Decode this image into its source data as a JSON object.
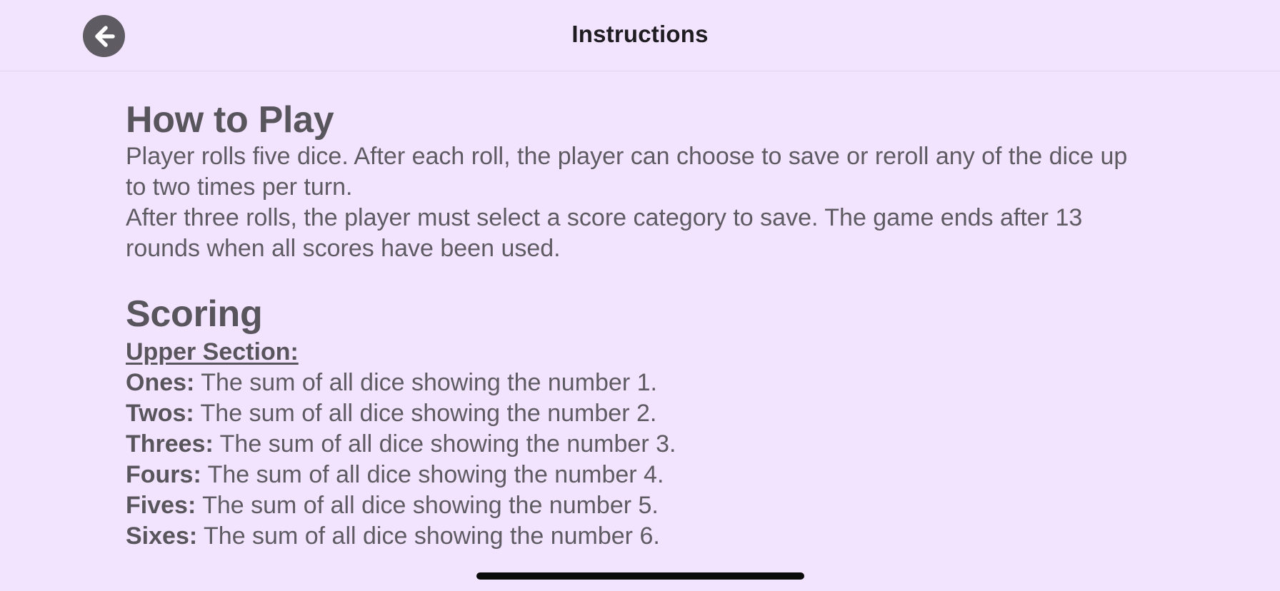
{
  "nav": {
    "title": "Instructions",
    "back_icon": "arrow-left-circle-icon"
  },
  "how_to_play": {
    "heading": "How to Play",
    "paragraphs": [
      "Player rolls five dice. After each roll, the player can choose to save or reroll any of the dice up to two times per turn.",
      "After three rolls, the player must select a score category to save. The game ends after 13 rounds when all scores have been used."
    ]
  },
  "scoring": {
    "heading": "Scoring",
    "upper_section_label": "Upper Section:",
    "items": [
      {
        "name": "Ones:",
        "desc": " The sum of all dice showing the number 1."
      },
      {
        "name": "Twos:",
        "desc": " The sum of all dice showing the number 2."
      },
      {
        "name": "Threes:",
        "desc": " The sum of all dice showing the number 3."
      },
      {
        "name": "Fours:",
        "desc": " The sum of all dice showing the number 4."
      },
      {
        "name": "Fives:",
        "desc": " The sum of all dice showing the number 5."
      },
      {
        "name": "Sixes:",
        "desc": " The sum of all dice showing the number 6."
      }
    ]
  },
  "colors": {
    "background": "#f2e3fe",
    "text": "#5f5b63",
    "title": "#1f1d22",
    "back_button": "#5f5b62",
    "home_indicator": "#0b0b0c"
  }
}
